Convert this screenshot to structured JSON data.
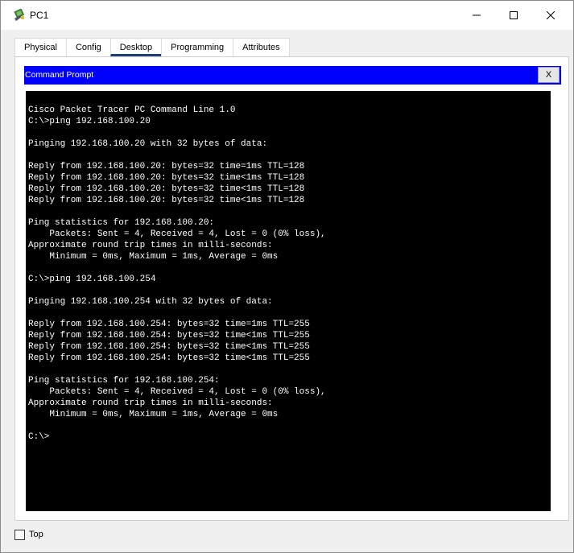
{
  "window": {
    "title": "PC1"
  },
  "tabs": [
    {
      "label": "Physical",
      "active": false
    },
    {
      "label": "Config",
      "active": false
    },
    {
      "label": "Desktop",
      "active": true
    },
    {
      "label": "Programming",
      "active": false
    },
    {
      "label": "Attributes",
      "active": false
    }
  ],
  "command_prompt": {
    "title": "Command Prompt",
    "close_label": "X",
    "output": "Cisco Packet Tracer PC Command Line 1.0\nC:\\>ping 192.168.100.20\n\nPinging 192.168.100.20 with 32 bytes of data:\n\nReply from 192.168.100.20: bytes=32 time=1ms TTL=128\nReply from 192.168.100.20: bytes=32 time<1ms TTL=128\nReply from 192.168.100.20: bytes=32 time<1ms TTL=128\nReply from 192.168.100.20: bytes=32 time<1ms TTL=128\n\nPing statistics for 192.168.100.20:\n    Packets: Sent = 4, Received = 4, Lost = 0 (0% loss),\nApproximate round trip times in milli-seconds:\n    Minimum = 0ms, Maximum = 1ms, Average = 0ms\n\nC:\\>ping 192.168.100.254\n\nPinging 192.168.100.254 with 32 bytes of data:\n\nReply from 192.168.100.254: bytes=32 time=1ms TTL=255\nReply from 192.168.100.254: bytes=32 time<1ms TTL=255\nReply from 192.168.100.254: bytes=32 time<1ms TTL=255\nReply from 192.168.100.254: bytes=32 time<1ms TTL=255\n\nPing statistics for 192.168.100.254:\n    Packets: Sent = 4, Received = 4, Lost = 0 (0% loss),\nApproximate round trip times in milli-seconds:\n    Minimum = 0ms, Maximum = 1ms, Average = 0ms\n\nC:\\>"
  },
  "footer": {
    "top_label": "Top",
    "top_checked": false
  },
  "colors": {
    "header_blue": "#0000ff",
    "terminal_bg": "#000000",
    "terminal_fg": "#ffffff",
    "active_tab_underline": "#1f3f7a"
  },
  "icons": {
    "app": "packet-tracer-pc-icon",
    "minimize": "minimize-icon",
    "maximize": "maximize-icon",
    "close": "close-icon"
  }
}
